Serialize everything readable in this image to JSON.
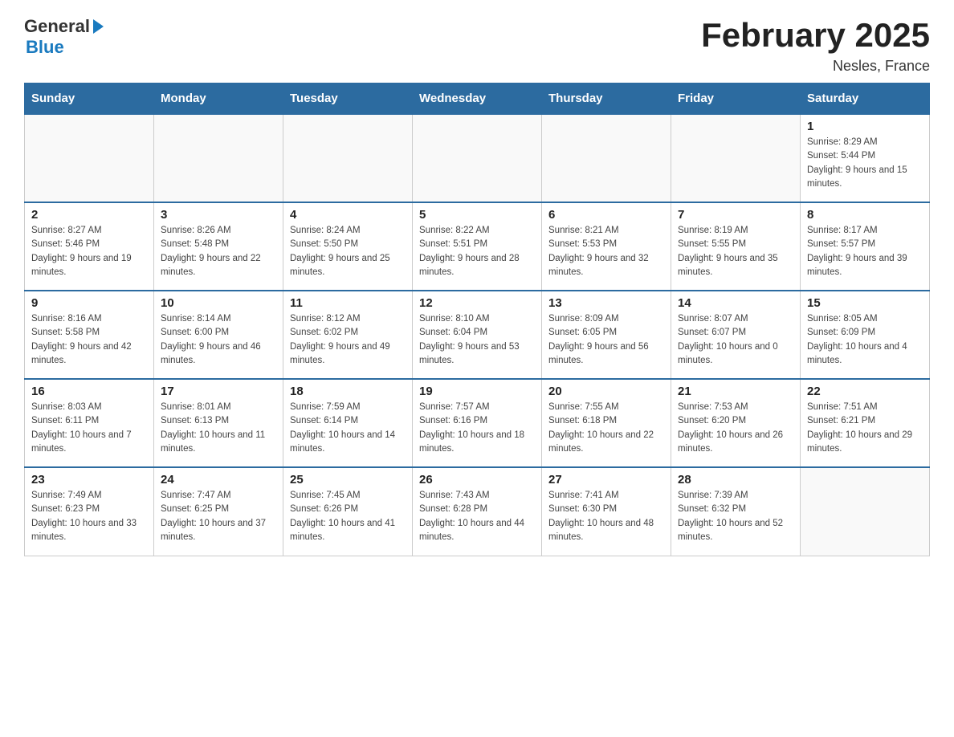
{
  "header": {
    "logo_general": "General",
    "logo_blue": "Blue",
    "title": "February 2025",
    "location": "Nesles, France"
  },
  "days_of_week": [
    "Sunday",
    "Monday",
    "Tuesday",
    "Wednesday",
    "Thursday",
    "Friday",
    "Saturday"
  ],
  "weeks": [
    [
      {
        "date": "",
        "info": ""
      },
      {
        "date": "",
        "info": ""
      },
      {
        "date": "",
        "info": ""
      },
      {
        "date": "",
        "info": ""
      },
      {
        "date": "",
        "info": ""
      },
      {
        "date": "",
        "info": ""
      },
      {
        "date": "1",
        "info": "Sunrise: 8:29 AM\nSunset: 5:44 PM\nDaylight: 9 hours and 15 minutes."
      }
    ],
    [
      {
        "date": "2",
        "info": "Sunrise: 8:27 AM\nSunset: 5:46 PM\nDaylight: 9 hours and 19 minutes."
      },
      {
        "date": "3",
        "info": "Sunrise: 8:26 AM\nSunset: 5:48 PM\nDaylight: 9 hours and 22 minutes."
      },
      {
        "date": "4",
        "info": "Sunrise: 8:24 AM\nSunset: 5:50 PM\nDaylight: 9 hours and 25 minutes."
      },
      {
        "date": "5",
        "info": "Sunrise: 8:22 AM\nSunset: 5:51 PM\nDaylight: 9 hours and 28 minutes."
      },
      {
        "date": "6",
        "info": "Sunrise: 8:21 AM\nSunset: 5:53 PM\nDaylight: 9 hours and 32 minutes."
      },
      {
        "date": "7",
        "info": "Sunrise: 8:19 AM\nSunset: 5:55 PM\nDaylight: 9 hours and 35 minutes."
      },
      {
        "date": "8",
        "info": "Sunrise: 8:17 AM\nSunset: 5:57 PM\nDaylight: 9 hours and 39 minutes."
      }
    ],
    [
      {
        "date": "9",
        "info": "Sunrise: 8:16 AM\nSunset: 5:58 PM\nDaylight: 9 hours and 42 minutes."
      },
      {
        "date": "10",
        "info": "Sunrise: 8:14 AM\nSunset: 6:00 PM\nDaylight: 9 hours and 46 minutes."
      },
      {
        "date": "11",
        "info": "Sunrise: 8:12 AM\nSunset: 6:02 PM\nDaylight: 9 hours and 49 minutes."
      },
      {
        "date": "12",
        "info": "Sunrise: 8:10 AM\nSunset: 6:04 PM\nDaylight: 9 hours and 53 minutes."
      },
      {
        "date": "13",
        "info": "Sunrise: 8:09 AM\nSunset: 6:05 PM\nDaylight: 9 hours and 56 minutes."
      },
      {
        "date": "14",
        "info": "Sunrise: 8:07 AM\nSunset: 6:07 PM\nDaylight: 10 hours and 0 minutes."
      },
      {
        "date": "15",
        "info": "Sunrise: 8:05 AM\nSunset: 6:09 PM\nDaylight: 10 hours and 4 minutes."
      }
    ],
    [
      {
        "date": "16",
        "info": "Sunrise: 8:03 AM\nSunset: 6:11 PM\nDaylight: 10 hours and 7 minutes."
      },
      {
        "date": "17",
        "info": "Sunrise: 8:01 AM\nSunset: 6:13 PM\nDaylight: 10 hours and 11 minutes."
      },
      {
        "date": "18",
        "info": "Sunrise: 7:59 AM\nSunset: 6:14 PM\nDaylight: 10 hours and 14 minutes."
      },
      {
        "date": "19",
        "info": "Sunrise: 7:57 AM\nSunset: 6:16 PM\nDaylight: 10 hours and 18 minutes."
      },
      {
        "date": "20",
        "info": "Sunrise: 7:55 AM\nSunset: 6:18 PM\nDaylight: 10 hours and 22 minutes."
      },
      {
        "date": "21",
        "info": "Sunrise: 7:53 AM\nSunset: 6:20 PM\nDaylight: 10 hours and 26 minutes."
      },
      {
        "date": "22",
        "info": "Sunrise: 7:51 AM\nSunset: 6:21 PM\nDaylight: 10 hours and 29 minutes."
      }
    ],
    [
      {
        "date": "23",
        "info": "Sunrise: 7:49 AM\nSunset: 6:23 PM\nDaylight: 10 hours and 33 minutes."
      },
      {
        "date": "24",
        "info": "Sunrise: 7:47 AM\nSunset: 6:25 PM\nDaylight: 10 hours and 37 minutes."
      },
      {
        "date": "25",
        "info": "Sunrise: 7:45 AM\nSunset: 6:26 PM\nDaylight: 10 hours and 41 minutes."
      },
      {
        "date": "26",
        "info": "Sunrise: 7:43 AM\nSunset: 6:28 PM\nDaylight: 10 hours and 44 minutes."
      },
      {
        "date": "27",
        "info": "Sunrise: 7:41 AM\nSunset: 6:30 PM\nDaylight: 10 hours and 48 minutes."
      },
      {
        "date": "28",
        "info": "Sunrise: 7:39 AM\nSunset: 6:32 PM\nDaylight: 10 hours and 52 minutes."
      },
      {
        "date": "",
        "info": ""
      }
    ]
  ]
}
